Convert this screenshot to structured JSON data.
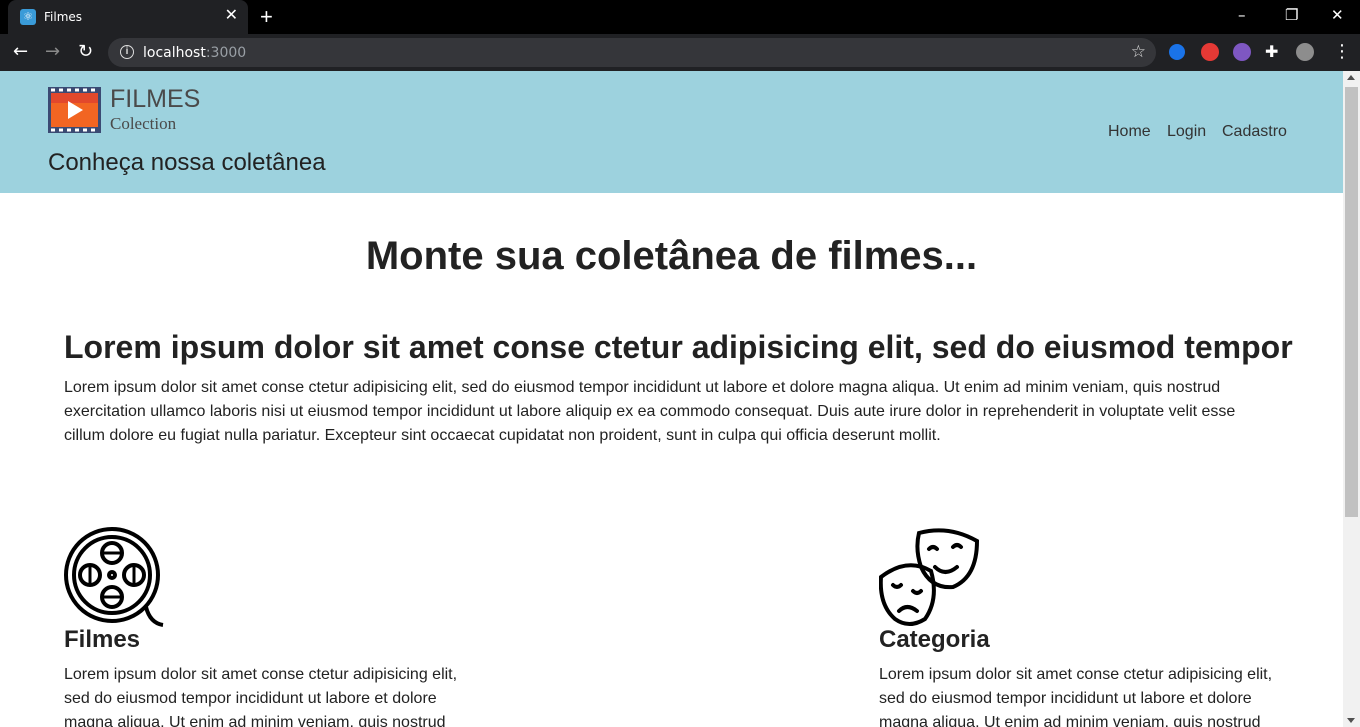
{
  "browser": {
    "tab_title": "Filmes",
    "url_host": "localhost",
    "url_port": ":3000"
  },
  "header": {
    "logo_title": "FILMES",
    "logo_subtitle": "Colection",
    "tagline": "Conheça nossa coletânea",
    "nav": [
      "Home",
      "Login",
      "Cadastro"
    ],
    "background": "#9dd2de"
  },
  "main": {
    "hero_title": "Monte sua coletânea de filmes...",
    "lead_title": "Lorem ipsum dolor sit amet conse ctetur adipisicing elit, sed do eiusmod tempor",
    "lead_text": "Lorem ipsum dolor sit amet conse ctetur adipisicing elit, sed do eiusmod tempor incididunt ut labore et dolore magna aliqua. Ut enim ad minim veniam, quis nostrud exercitation ullamco laboris nisi ut eiusmod tempor incididunt ut labore aliquip ex ea commodo consequat. Duis aute irure dolor in reprehenderit in voluptate velit esse cillum dolore eu fugiat nulla pariatur. Excepteur sint occaecat cupidatat non proident, sunt in culpa qui officia deserunt mollit.",
    "features": [
      {
        "icon": "film-reel-icon",
        "title": "Filmes",
        "text": "Lorem ipsum dolor sit amet conse ctetur adipisicing elit, sed do eiusmod tempor incididunt ut labore et dolore magna aliqua. Ut enim ad minim veniam, quis nostrud"
      },
      {
        "icon": "theater-masks-icon",
        "title": "Categoria",
        "text": "Lorem ipsum dolor sit amet conse ctetur adipisicing elit, sed do eiusmod tempor incididunt ut labore et dolore magna aliqua. Ut enim ad minim veniam, quis nostrud"
      }
    ]
  }
}
